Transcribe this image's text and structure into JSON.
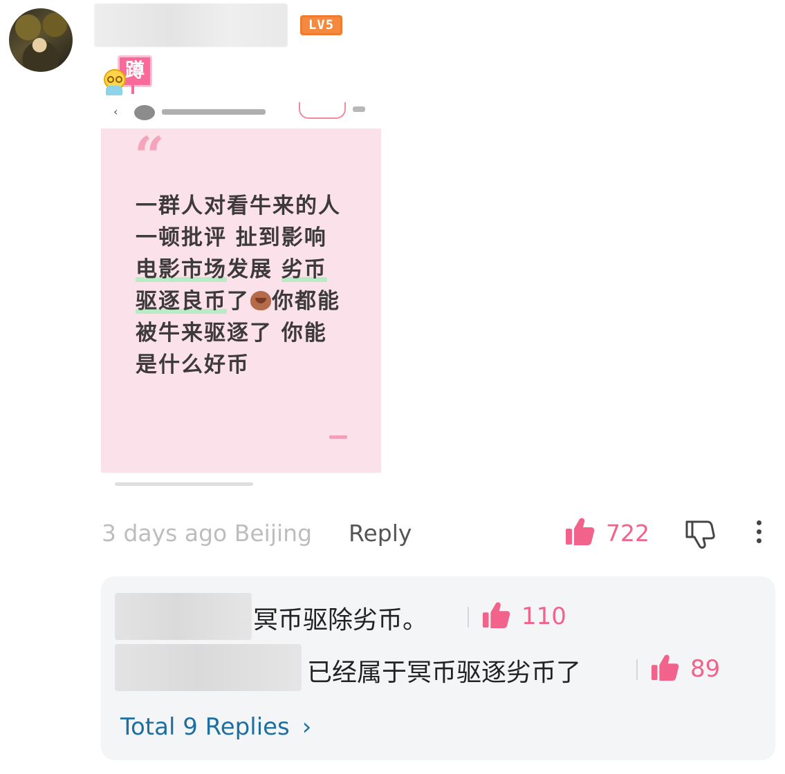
{
  "comment": {
    "level_badge": "LV5",
    "sticker_char": "蹲",
    "screenshot": {
      "lines": [
        "一群人对看牛来的人",
        "一顿批评  扯到影响",
        "电影市场发展 劣币",
        "驱逐良币了",
        "你都能",
        "被牛来驱逐了 你能",
        "是什么好币"
      ]
    },
    "time_location": "3 days ago Beijing",
    "reply_label": "Reply",
    "like_count": "722",
    "accent_color": "#f2638c"
  },
  "replies": {
    "items": [
      {
        "text": "冥币驱除劣币。",
        "likes": "110"
      },
      {
        "text": "已经属于冥币驱逐劣币了",
        "likes": "89"
      }
    ],
    "total_label": "Total 9 Replies",
    "link_color": "#1e6fa0"
  },
  "icons": {
    "like": "thumbs-up-icon",
    "dislike": "thumbs-down-icon",
    "more": "more-vertical-icon",
    "chevron": "chevron-right-icon"
  }
}
